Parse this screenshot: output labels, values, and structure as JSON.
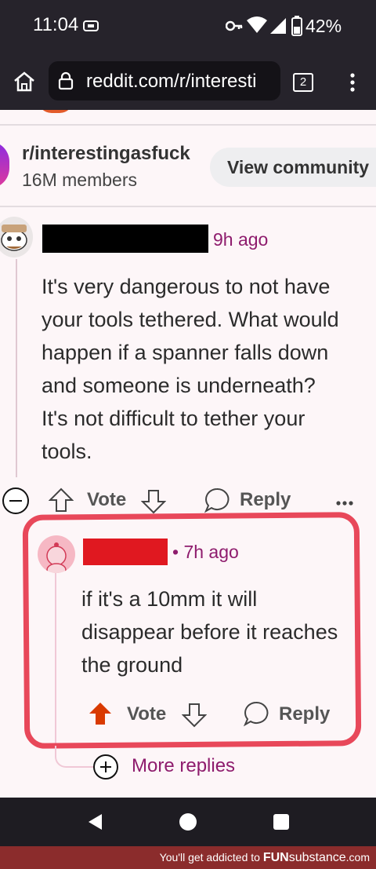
{
  "status": {
    "time": "11:04",
    "battery": "42%"
  },
  "browser": {
    "url": "reddit.com/r/interesti",
    "tab_count": "2"
  },
  "community": {
    "name": "r/interestingasfuck",
    "members": "16M members",
    "view_label": "View community"
  },
  "comment1": {
    "time": "9h ago",
    "body_lines": [
      "It's very dangerous to not have",
      "your tools tethered. What would",
      "happen if a spanner falls down",
      "and someone is underneath?",
      "It's not difficult to tether your",
      "tools."
    ],
    "vote_label": "Vote",
    "reply_label": "Reply"
  },
  "comment2": {
    "time": "7h ago",
    "body_lines": [
      "if it's a 10mm it will",
      "disappear before it reaches",
      "the ground"
    ],
    "vote_label": "Vote",
    "reply_label": "Reply"
  },
  "more_replies": "More replies",
  "footer": {
    "prefix": "You'll get addicted to ",
    "brand_bold": "FUN",
    "brand_rest": "substance",
    "suffix": ".com"
  },
  "colors": {
    "accent": "#8e1c6d",
    "highlight": "#e8485a",
    "upvote": "#d93a00"
  }
}
